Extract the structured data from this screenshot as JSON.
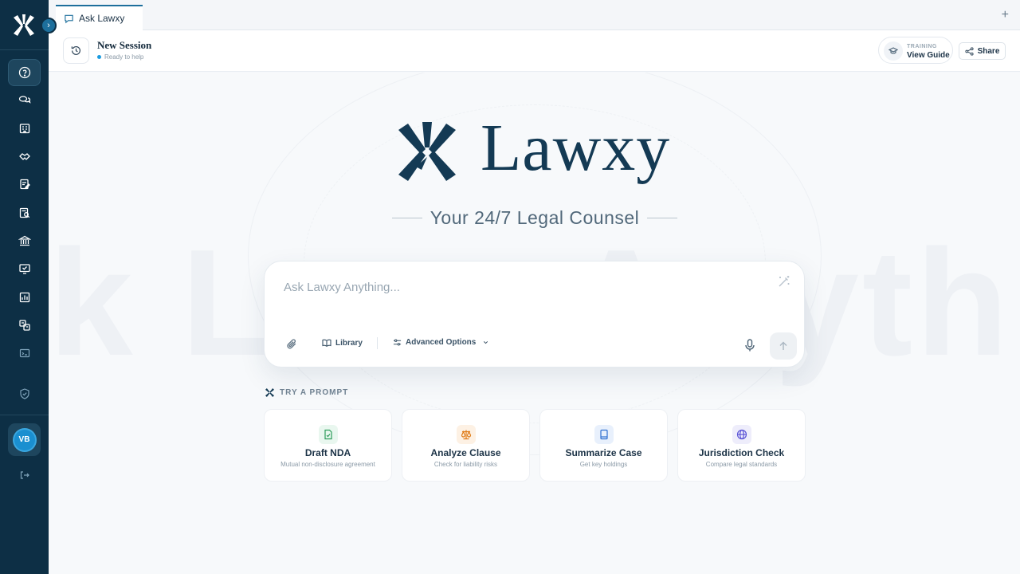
{
  "sidebar": {
    "logo": "lawxy-x-logo",
    "avatar_initials": "VB",
    "items": [
      {
        "icon": "help-circle-icon",
        "active": true
      },
      {
        "icon": "chat-bubbles-icon"
      },
      {
        "icon": "building-icon"
      },
      {
        "icon": "handshake-icon"
      },
      {
        "icon": "document-edit-icon"
      },
      {
        "icon": "document-search-icon"
      },
      {
        "icon": "bank-icon"
      },
      {
        "icon": "monitor-check-icon"
      },
      {
        "icon": "report-icon"
      },
      {
        "icon": "translate-icon"
      },
      {
        "icon": "terminal-icon"
      },
      {
        "icon": "shield-check-icon"
      },
      {
        "icon": "logout-icon"
      }
    ]
  },
  "tabs": [
    {
      "label": "Ask Lawxy",
      "active": true
    }
  ],
  "session": {
    "title": "New Session",
    "status": "Ready to help",
    "guide_overline": "TRAINING",
    "guide_label": "View Guide",
    "share_label": "Share"
  },
  "hero": {
    "brand": "Lawxy",
    "tagline": "Your 24/7 Legal Counsel",
    "background_text_left": "k Lav",
    "background_text_right": "Anyth"
  },
  "ask": {
    "placeholder": "Ask Lawxy Anything...",
    "library_label": "Library",
    "advanced_label": "Advanced Options"
  },
  "prompts": {
    "heading": "TRY A PROMPT",
    "cards": [
      {
        "title": "Draft NDA",
        "subtitle": "Mutual non-disclosure agreement",
        "icon": "file-check-icon",
        "color": "#2e9d5b",
        "bg": "#e9f7ef"
      },
      {
        "title": "Analyze Clause",
        "subtitle": "Check for liability risks",
        "icon": "scales-icon",
        "color": "#e07b16",
        "bg": "#fdf1e4"
      },
      {
        "title": "Summarize Case",
        "subtitle": "Get key holdings",
        "icon": "book-icon",
        "color": "#2f6fd0",
        "bg": "#e8f0fc"
      },
      {
        "title": "Jurisdiction Check",
        "subtitle": "Compare legal standards",
        "icon": "globe-icon",
        "color": "#5b54d6",
        "bg": "#eeedfb"
      }
    ]
  },
  "colors": {
    "sidebar": "#0d2f45",
    "brand": "#143a54",
    "accent": "#1d6f9c",
    "status_dot": "#1a9be0"
  }
}
